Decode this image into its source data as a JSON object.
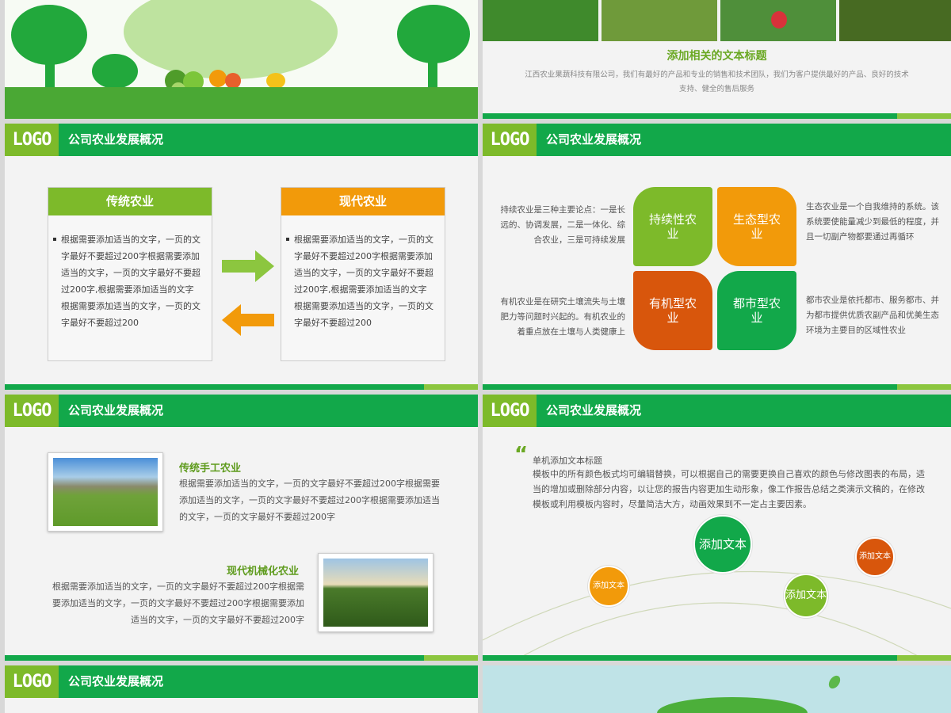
{
  "common": {
    "logo": "LOGO",
    "header_title": "公司农业发展概况"
  },
  "slide2": {
    "title": "添加相关的文本标题",
    "body": "江西农业果蔬科技有限公司，我们有最好的产品和专业的销售和技术团队，我们为客户提供最好的产品、良好的技术支持、健全的售后服务"
  },
  "slide3": {
    "left_card": {
      "title": "传统农业",
      "body": "根据需要添加适当的文字，一页的文字最好不要超过200字根据需要添加适当的文字，一页的文字最好不要超过200字,根据需要添加适当的文字根据需要添加适当的文字，一页的文字最好不要超过200"
    },
    "right_card": {
      "title": "现代农业",
      "body": "根据需要添加适当的文字，一页的文字最好不要超过200字根据需要添加适当的文字，一页的文字最好不要超过200字,根据需要添加适当的文字根据需要添加适当的文字，一页的文字最好不要超过200"
    }
  },
  "slide4": {
    "petals": [
      "持续性农业",
      "生态型农业",
      "有机型农业",
      "都市型农业"
    ],
    "text_tl": "持续农业是三种主要论点：一是长远的、协调发展，二是一体化、综合农业，三是可持续发展",
    "text_tr": "生态农业是一个自我维持的系统。该系统要使能量减少到最低的程度，并且一切副产物都要通过再循环",
    "text_bl": "有机农业是在研究土壤流失与土壤肥力等问题时兴起的。有机农业的着重点放在土壤与人类健康上",
    "text_br": "都市农业是依托都市、服务都市、并为都市提供优质农副产品和优美生态环境为主要目的区域性农业"
  },
  "slide5": {
    "item1_title": "传统手工农业",
    "item1_body": "根据需要添加适当的文字，一页的文字最好不要超过200字根据需要添加适当的文字，一页的文字最好不要超过200字根据需要添加适当的文字，一页的文字最好不要超过200字",
    "item2_title": "现代机械化农业",
    "item2_body": "根据需要添加适当的文字，一页的文字最好不要超过200字根据需要添加适当的文字，一页的文字最好不要超过200字根据需要添加适当的文字，一页的文字最好不要超过200字"
  },
  "slide6": {
    "quote_mark": "“",
    "heading": "单机添加文本标题",
    "body": "模板中的所有颜色板式均可编辑替换，可以根据自己的需要更换自己喜欢的颜色与修改图表的布局，适当的增加或删除部分内容，以让您的报告内容更加生动形象，像工作报告总结之类演示文稿的，在修改模板或利用模板内容时，尽量简洁大方，动画效果到不一定占主要因素。",
    "bubbles": [
      "添加文本",
      "添加文本",
      "添加文本",
      "添加文本"
    ]
  },
  "colors": {
    "brand_green": "#12a84a",
    "lime": "#7dba2a",
    "orange": "#f29a0a",
    "rust": "#d8560c"
  }
}
